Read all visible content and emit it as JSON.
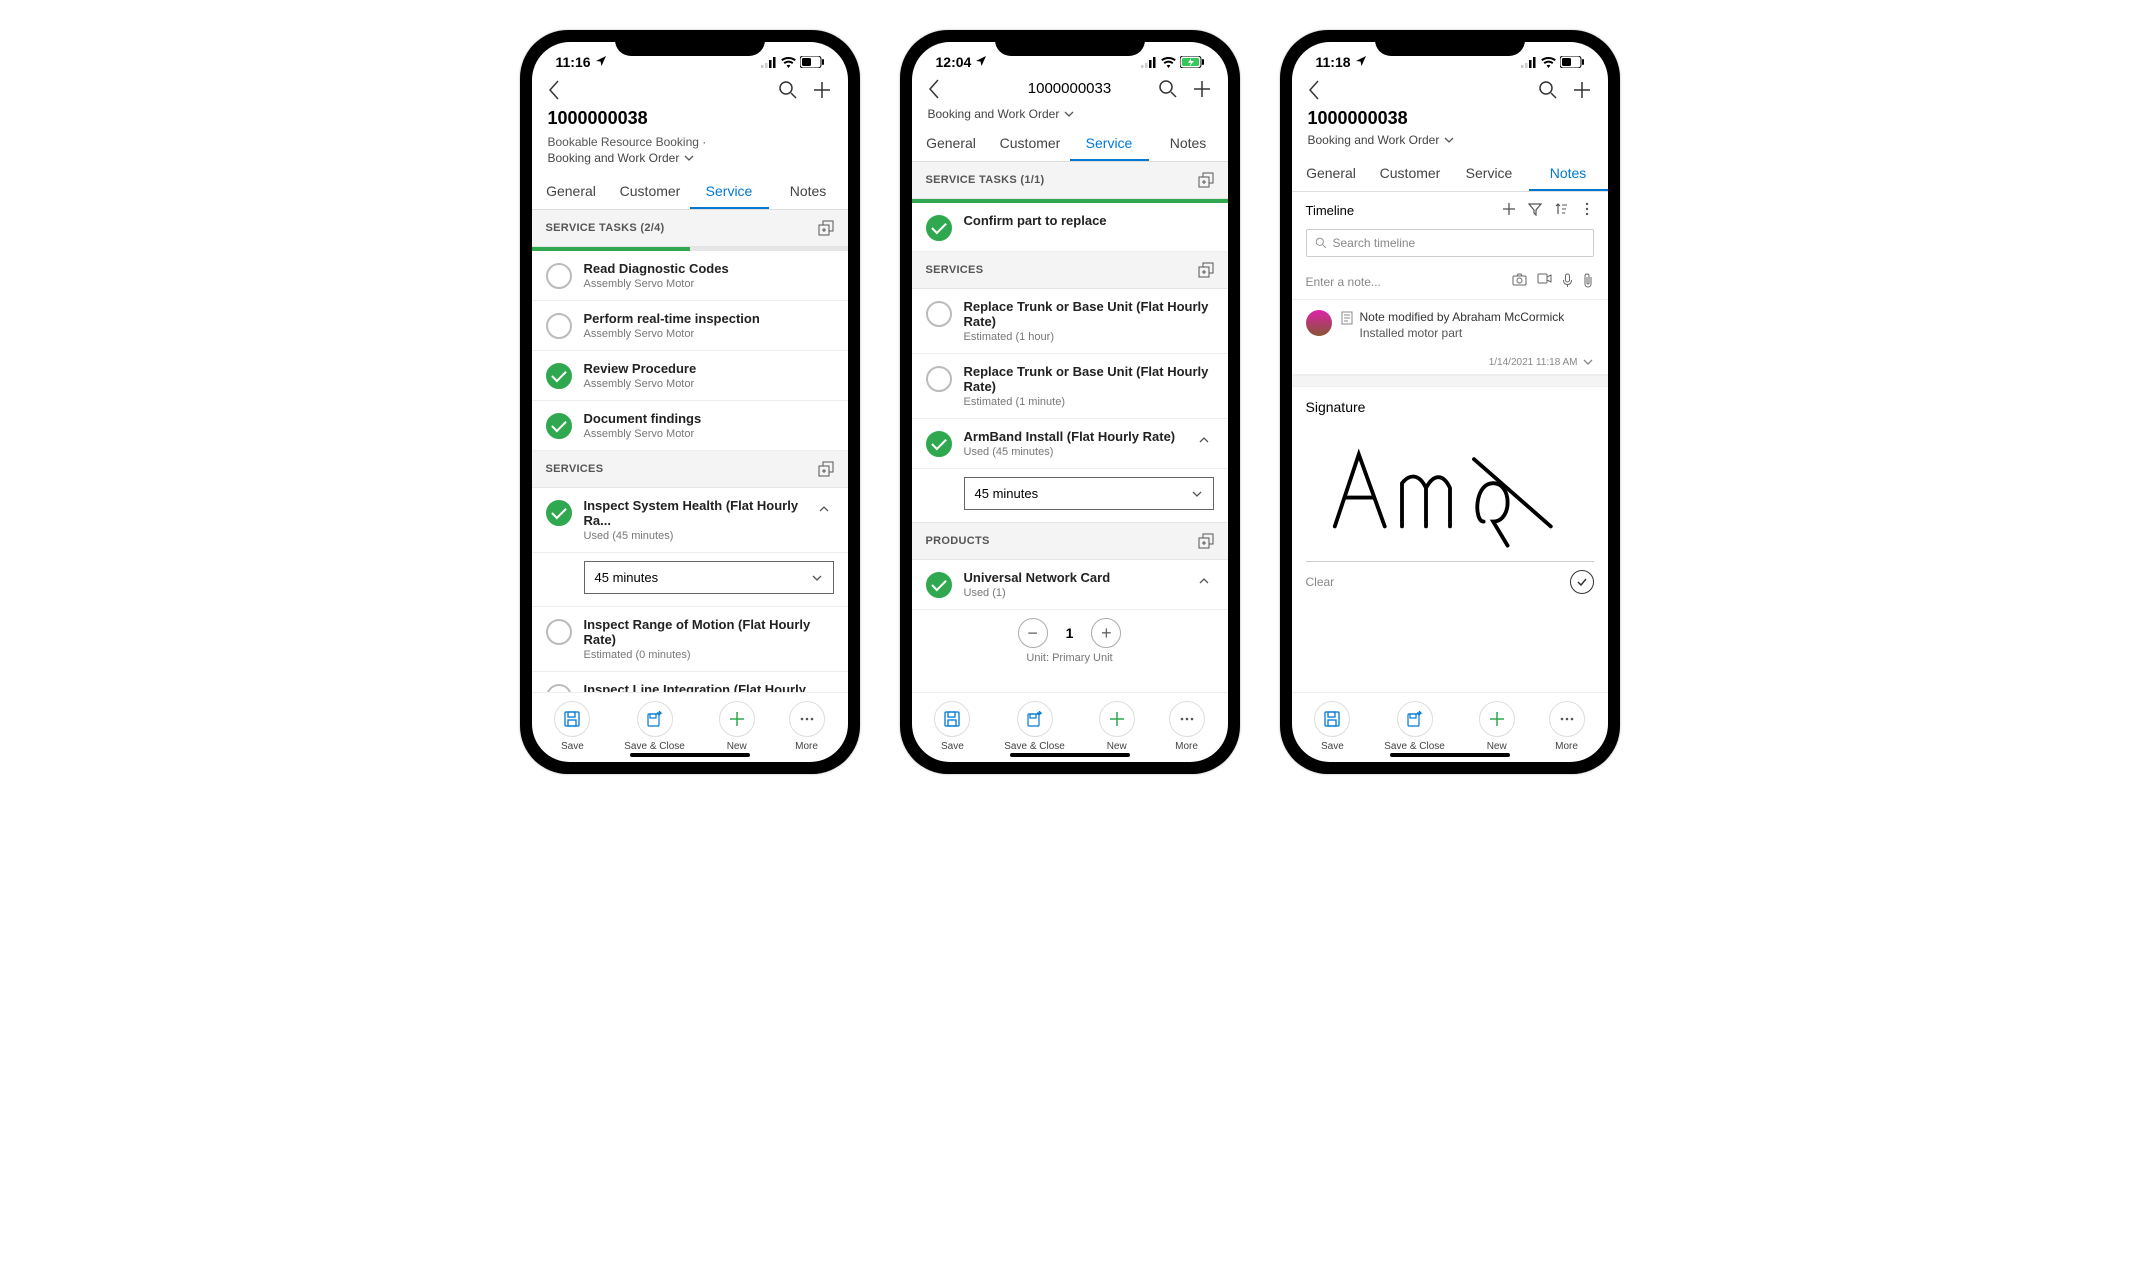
{
  "phones": [
    {
      "status": {
        "time": "11:16",
        "loc": true,
        "battery": "low"
      },
      "headerMode": "full",
      "title": "1000000038",
      "subtitle": "Bookable Resource Booking  ·",
      "formSwitch": "Booking and Work Order",
      "tabs": [
        "General",
        "Customer",
        "Service",
        "Notes"
      ],
      "activeTab": 2,
      "sections": [
        {
          "type": "tasks",
          "label": "SERVICE TASKS (2/4)",
          "add": true,
          "progress": 50,
          "items": [
            {
              "done": false,
              "title": "Read Diagnostic Codes",
              "sub": "Assembly Servo Motor"
            },
            {
              "done": false,
              "title": "Perform real-time inspection",
              "sub": "Assembly Servo Motor"
            },
            {
              "done": true,
              "title": "Review Procedure",
              "sub": "Assembly Servo Motor"
            },
            {
              "done": true,
              "title": "Document findings",
              "sub": "Assembly Servo Motor"
            }
          ]
        },
        {
          "type": "services",
          "label": "SERVICES",
          "add": true,
          "items": [
            {
              "done": true,
              "title": "Inspect System Health (Flat Hourly Ra...",
              "sub": "Used (45 minutes)",
              "expand": true,
              "dropdown": "45 minutes"
            },
            {
              "done": false,
              "title": "Inspect Range of Motion (Flat Hourly Rate)",
              "sub": "Estimated (0 minutes)"
            },
            {
              "done": false,
              "title": "Inspect Line Integration (Flat Hourly Rate)",
              "sub": ""
            }
          ]
        }
      ]
    },
    {
      "status": {
        "time": "12:04",
        "loc": true,
        "battery": "charging"
      },
      "headerMode": "compact",
      "title": "1000000033",
      "formSwitch": "Booking and Work Order",
      "tabs": [
        "General",
        "Customer",
        "Service",
        "Notes"
      ],
      "activeTab": 2,
      "sections": [
        {
          "type": "tasks",
          "label": "SERVICE TASKS (1/1)",
          "add": true,
          "progress": 100,
          "items": [
            {
              "done": true,
              "title": "Confirm part to replace",
              "sub": ""
            }
          ]
        },
        {
          "type": "services",
          "label": "SERVICES",
          "add": true,
          "items": [
            {
              "done": false,
              "title": "Replace Trunk or Base Unit (Flat Hourly Rate)",
              "sub": "Estimated (1 hour)"
            },
            {
              "done": false,
              "title": "Replace Trunk or Base Unit (Flat Hourly Rate)",
              "sub": "Estimated (1 minute)"
            },
            {
              "done": true,
              "title": "ArmBand Install (Flat Hourly Rate)",
              "sub": "Used (45 minutes)",
              "expand": true,
              "dropdown": "45 minutes"
            }
          ]
        },
        {
          "type": "products",
          "label": "PRODUCTS",
          "add": true,
          "items": [
            {
              "done": true,
              "title": "Universal Network Card",
              "sub": "Used (1)",
              "expand": true,
              "counter": {
                "value": "1",
                "unit": "Unit: Primary Unit"
              }
            }
          ]
        }
      ]
    },
    {
      "status": {
        "time": "11:18",
        "loc": true,
        "battery": "low"
      },
      "headerMode": "full-noSubtitle",
      "title": "1000000038",
      "formSwitch": "Booking and Work Order",
      "tabs": [
        "General",
        "Customer",
        "Service",
        "Notes"
      ],
      "activeTab": 3,
      "notes": {
        "heading": "Timeline",
        "searchPlaceholder": "Search timeline",
        "enterPlaceholder": "Enter a note...",
        "entry": {
          "title": "Note modified by Abraham McCormick",
          "body": "Installed motor part",
          "time": "1/14/2021 11:18 AM"
        },
        "signatureLabel": "Signature",
        "clearLabel": "Clear"
      }
    }
  ],
  "toolbar": [
    {
      "key": "save",
      "label": "Save"
    },
    {
      "key": "saveclose",
      "label": "Save & Close"
    },
    {
      "key": "new",
      "label": "New"
    },
    {
      "key": "more",
      "label": "More"
    }
  ]
}
